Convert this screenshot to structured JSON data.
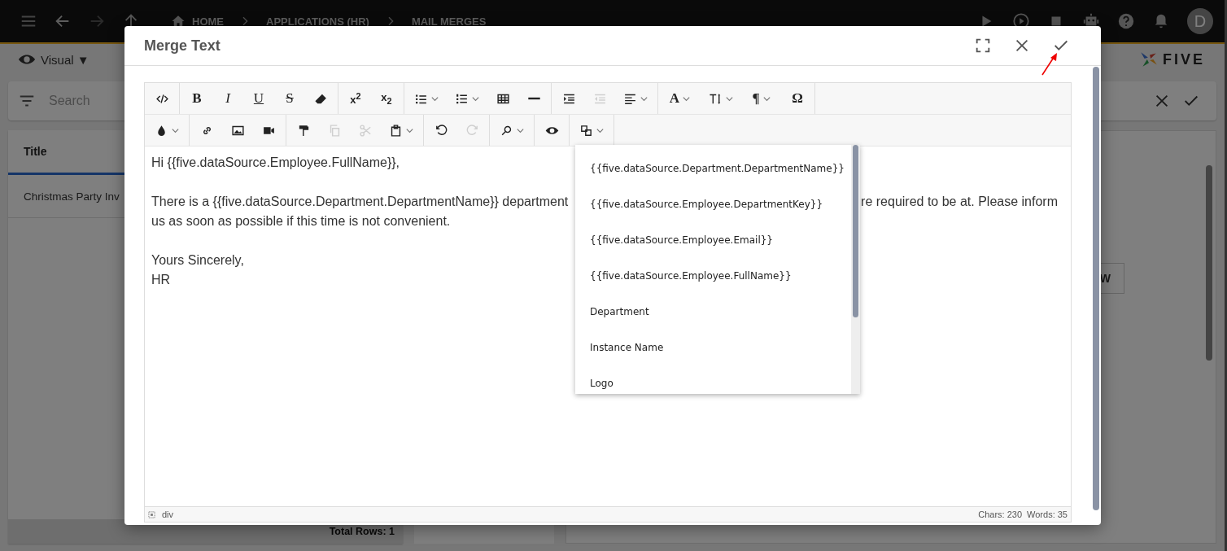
{
  "topbar": {
    "breadcrumbs": [
      {
        "label": "HOME",
        "kind": "home"
      },
      {
        "label": "APPLICATIONS (HR)",
        "kind": "plain"
      },
      {
        "label": "MAIL MERGES",
        "kind": "plain"
      }
    ],
    "avatar": "D"
  },
  "subbar": {
    "view_mode": "Visual ▼",
    "logo": "FIVE"
  },
  "search": {
    "placeholder": "Search"
  },
  "list": {
    "column": "Title",
    "rows": [
      "Christmas Party Inv"
    ],
    "footer": "Total Rows: 1"
  },
  "side_button": "W",
  "dialog": {
    "title": "Merge Text",
    "toolbar": [
      [
        [
          {
            "kind": "icon",
            "dropdown": false,
            "disabled": false
          }
        ],
        [
          {
            "kind": "bold",
            "label": "B",
            "dropdown": false,
            "disabled": false
          },
          {
            "kind": "italic",
            "label": "I",
            "dropdown": false,
            "disabled": false
          },
          {
            "kind": "underline",
            "label": "U",
            "dropdown": false,
            "disabled": false
          },
          {
            "kind": "strike",
            "label": "S",
            "dropdown": false,
            "disabled": false
          },
          {
            "kind": "icon",
            "dropdown": false,
            "disabled": false
          }
        ],
        [
          {
            "kind": "script",
            "label": "x$^{2}$",
            "dropdown": false,
            "disabled": false
          },
          {
            "kind": "script",
            "label": "x$_{2}$",
            "dropdown": false,
            "disabled": false
          }
        ],
        [
          {
            "kind": "icon",
            "dropdown": true,
            "disabled": false
          },
          {
            "kind": "icon",
            "dropdown": true,
            "disabled": false
          },
          {
            "kind": "icon",
            "dropdown": false,
            "disabled": false
          },
          {
            "kind": "icon",
            "dropdown": false,
            "disabled": false
          }
        ],
        [
          {
            "kind": "icon",
            "dropdown": false,
            "disabled": false
          },
          {
            "kind": "icon",
            "dropdown": false,
            "disabled": true
          },
          {
            "kind": "icon",
            "dropdown": true,
            "disabled": false
          }
        ],
        [
          {
            "kind": "bold",
            "label": "A",
            "dropdown": true,
            "disabled": false
          },
          {
            "kind": "icon",
            "dropdown": true,
            "disabled": false
          },
          {
            "kind": "bold",
            "label": "¶",
            "dropdown": true,
            "disabled": false
          },
          {
            "kind": "bold",
            "label": "Ω",
            "dropdown": false,
            "disabled": false
          }
        ]
      ],
      [
        [
          {
            "kind": "icon",
            "dropdown": true,
            "disabled": false
          }
        ],
        [
          {
            "kind": "icon",
            "dropdown": false,
            "disabled": false
          },
          {
            "kind": "icon",
            "dropdown": false,
            "disabled": false
          },
          {
            "kind": "icon",
            "dropdown": false,
            "disabled": false
          }
        ],
        [
          {
            "kind": "icon",
            "dropdown": false,
            "disabled": false
          },
          {
            "kind": "icon",
            "dropdown": false,
            "disabled": true
          },
          {
            "kind": "icon",
            "dropdown": false,
            "disabled": true
          },
          {
            "kind": "icon",
            "dropdown": true,
            "disabled": false
          }
        ],
        [
          {
            "kind": "icon",
            "dropdown": false,
            "disabled": false
          },
          {
            "kind": "icon",
            "dropdown": false,
            "disabled": true
          }
        ],
        [
          {
            "kind": "icon",
            "dropdown": true,
            "disabled": false
          }
        ],
        [
          {
            "kind": "icon",
            "dropdown": false,
            "disabled": false
          }
        ],
        [
          {
            "kind": "icon",
            "dropdown": true,
            "disabled": false
          }
        ]
      ]
    ],
    "content": [
      {
        "kind": "line",
        "text": "Hi {{five.dataSource.Employee.FullName}},"
      },
      {
        "kind": "blank"
      },
      {
        "kind": "split",
        "left": "There is a {{five.dataSource.Department.DepartmentName}} department",
        "right": "re required to be at. Please inform"
      },
      {
        "kind": "line",
        "text": "us as soon as possible if this time is not convenient."
      },
      {
        "kind": "blank"
      },
      {
        "kind": "line",
        "text": "Yours Sincerely,"
      },
      {
        "kind": "line",
        "text": "HR"
      }
    ],
    "merge_fields": [
      "{{five.dataSource.Department.DepartmentName}}",
      "{{five.dataSource.Employee.DepartmentKey}}",
      "{{five.dataSource.Employee.Email}}",
      "{{five.dataSource.Employee.FullName}}",
      "Department",
      "Instance Name",
      "Logo"
    ],
    "status": {
      "path": "div",
      "chars": "Chars: 230",
      "words": "Words: 35"
    }
  }
}
